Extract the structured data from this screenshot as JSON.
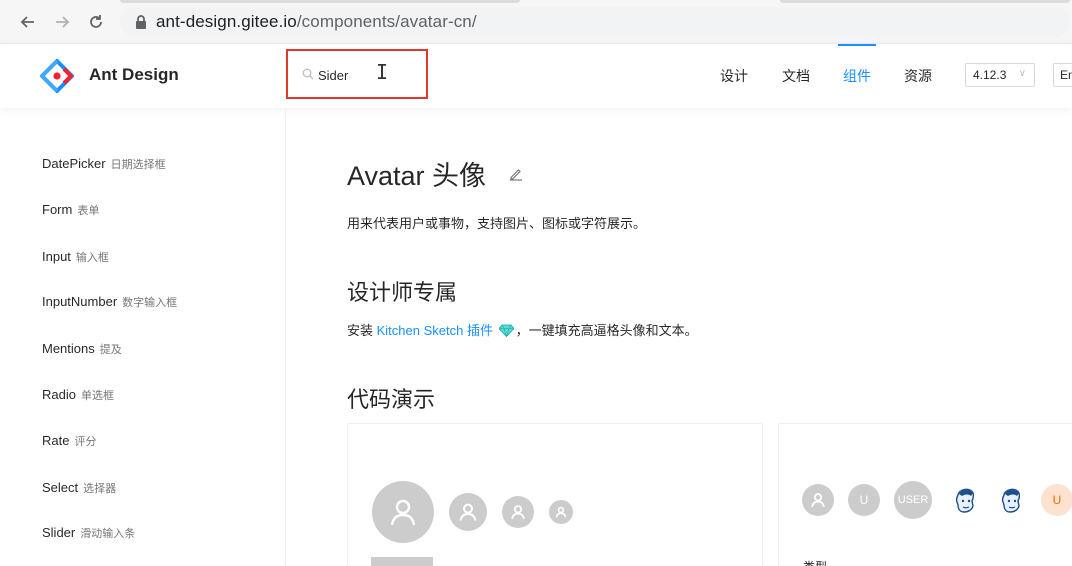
{
  "browser": {
    "url_host": "ant-design.gitee.io",
    "url_path": "/components/avatar-cn/"
  },
  "header": {
    "brand": "Ant Design",
    "search_value": "Sider",
    "menu": [
      {
        "label": "设计"
      },
      {
        "label": "文档"
      },
      {
        "label": "组件",
        "active": true
      },
      {
        "label": "资源"
      }
    ],
    "version": "4.12.3",
    "language": "En",
    "accent_color": "#1890ff",
    "highlight_box_color": "#e0382b"
  },
  "sidebar": {
    "items": [
      {
        "en": "DatePicker",
        "cn": "日期选择框"
      },
      {
        "en": "Form",
        "cn": "表单"
      },
      {
        "en": "Input",
        "cn": "输入框"
      },
      {
        "en": "InputNumber",
        "cn": "数字输入框"
      },
      {
        "en": "Mentions",
        "cn": "提及"
      },
      {
        "en": "Radio",
        "cn": "单选框"
      },
      {
        "en": "Rate",
        "cn": "评分"
      },
      {
        "en": "Select",
        "cn": "选择器"
      },
      {
        "en": "Slider",
        "cn": "滑动输入条"
      }
    ]
  },
  "main": {
    "title": "Avatar 头像",
    "description": "用来代表用户或事物，支持图片、图标或字符展示。",
    "designer_heading": "设计师专属",
    "sketch_prefix": "安装 ",
    "sketch_link": "Kitchen Sketch 插件",
    "sketch_suffix": "，一键填充高逼格头像和文本。",
    "demo_heading": "代码演示",
    "demo2_avatars": {
      "u1": "U",
      "user": "USER",
      "u2": "U"
    },
    "type_label": "类型 ⌄"
  }
}
